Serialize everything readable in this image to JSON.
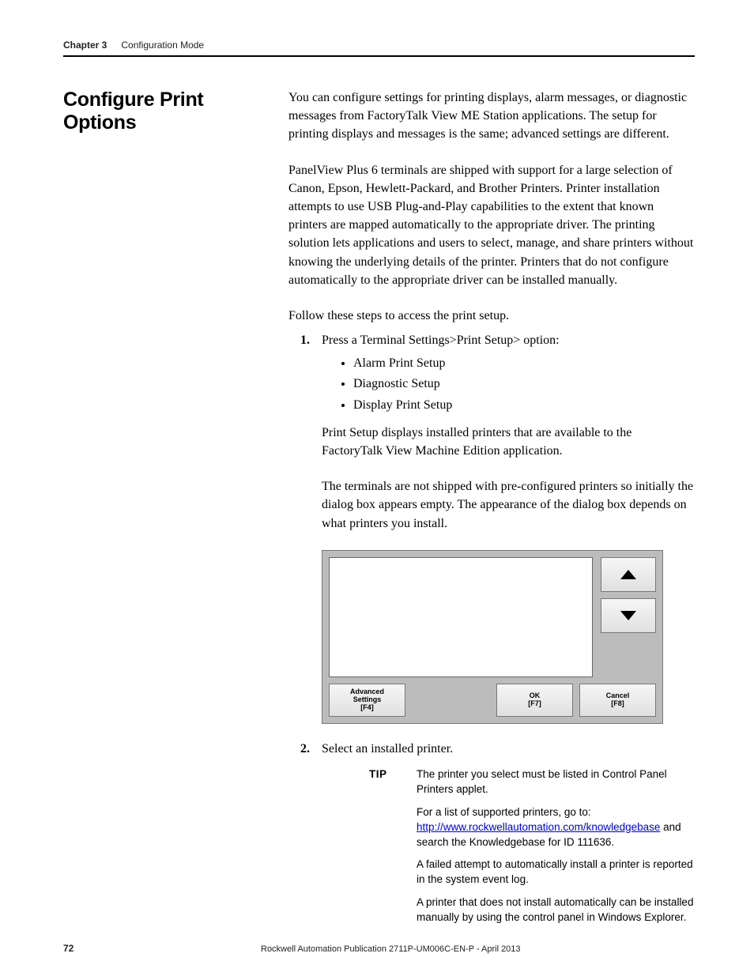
{
  "header": {
    "chapter": "Chapter 3",
    "title": "Configuration Mode"
  },
  "sideHeading": "Configure Print Options",
  "body": {
    "p1": "You can configure settings for printing displays, alarm messages, or diagnostic messages from FactoryTalk View ME Station applications. The setup for printing displays and messages is the same; advanced settings are different.",
    "p2": "PanelView Plus 6 terminals are shipped with support for a large selection of Canon, Epson, Hewlett-Packard, and Brother Printers. Printer installation attempts to use USB Plug-and-Play capabilities to the extent that known printers are mapped automatically to the appropriate driver. The printing solution lets applications and users to select, manage, and share printers without knowing the underlying details of the printer. Printers that do not configure automatically to the appropriate driver can be installed manually.",
    "p3": "Follow these steps to access the print setup."
  },
  "steps": {
    "s1": {
      "marker": "1.",
      "text": "Press a Terminal Settings>Print Setup> option:",
      "bullets": [
        "Alarm Print Setup",
        "Diagnostic Setup",
        "Display Print Setup"
      ],
      "after1": "Print Setup displays installed printers that are available to the FactoryTalk View Machine Edition application.",
      "after2": "The terminals are not shipped with pre-configured printers so initially the dialog box appears empty. The appearance of the dialog box depends on what printers you install."
    },
    "s2": {
      "marker": "2.",
      "text": "Select an installed printer."
    }
  },
  "dialog": {
    "buttons": {
      "advanced": "Advanced\nSettings\n[F4]",
      "ok": "OK\n[F7]",
      "cancel": "Cancel\n[F8]"
    }
  },
  "tip": {
    "label": "TIP",
    "p1": "The printer you select must be listed in Control Panel Printers applet.",
    "p2a": "For a list of supported printers, go to:",
    "link": "http://www.rockwellautomation.com/knowledgebase",
    "p2b": " and search the Knowledgebase for ID 111636.",
    "p3": "A failed attempt to automatically install a printer is reported in the system event log.",
    "p4": "A printer that does not install automatically can be installed manually by using the control panel in Windows Explorer."
  },
  "footer": {
    "pageNumber": "72",
    "publication": "Rockwell Automation Publication 2711P-UM006C-EN-P - April 2013"
  }
}
